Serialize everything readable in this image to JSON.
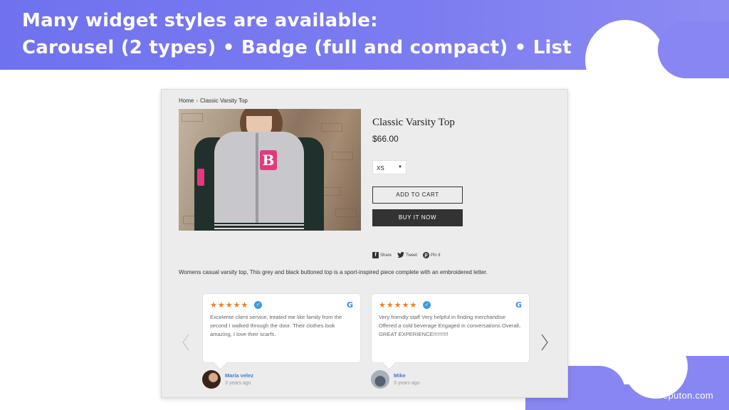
{
  "banner": {
    "line1": "Many widget styles are available:",
    "line2": "Carousel (2 types)  •  Badge (full and compact) • List"
  },
  "brand": "reputon.com",
  "shop": {
    "breadcrumb": {
      "home": "Home",
      "separator": "›",
      "current": "Classic Varsity Top"
    },
    "product": {
      "title": "Classic Varsity Top",
      "price": "$66.00",
      "variant_value": "XS",
      "add_to_cart": "ADD TO CART",
      "buy_now": "BUY IT NOW",
      "description": "Womens casual varsity top, This grey and black buttoned top is a sport-inspired piece complete with an embroidered letter.",
      "image_letter": "B"
    },
    "share": {
      "facebook": "Share",
      "twitter": "Tweet",
      "pinterest": "Pin it"
    },
    "reviews": [
      {
        "stars": "★★★★★",
        "text": "Excelente client service, treated me like family from the second I walked through the door. Their clothes look amazing, I love their scarfs.",
        "name": "Maria velez",
        "time": "3 years ago"
      },
      {
        "stars": "★★★★★",
        "text": "Very friendly staff Very helpful in finding merchandise Offered a cold beverage Engaged in conversations Overall, GREAT EXPERIENCE!!!!!!!!!!",
        "name": "Mike",
        "time": "3 years ago"
      }
    ]
  },
  "icons": {
    "verified": "verified-badge-icon",
    "google": "google-logo-icon",
    "prev": "chevron-left-icon",
    "next": "chevron-right-icon"
  },
  "colors": {
    "banner": "#7577ef",
    "star": "#f07d22",
    "verified": "#3b9be0",
    "reviewer_name": "#3b7dd8",
    "buy_button": "#333333"
  }
}
